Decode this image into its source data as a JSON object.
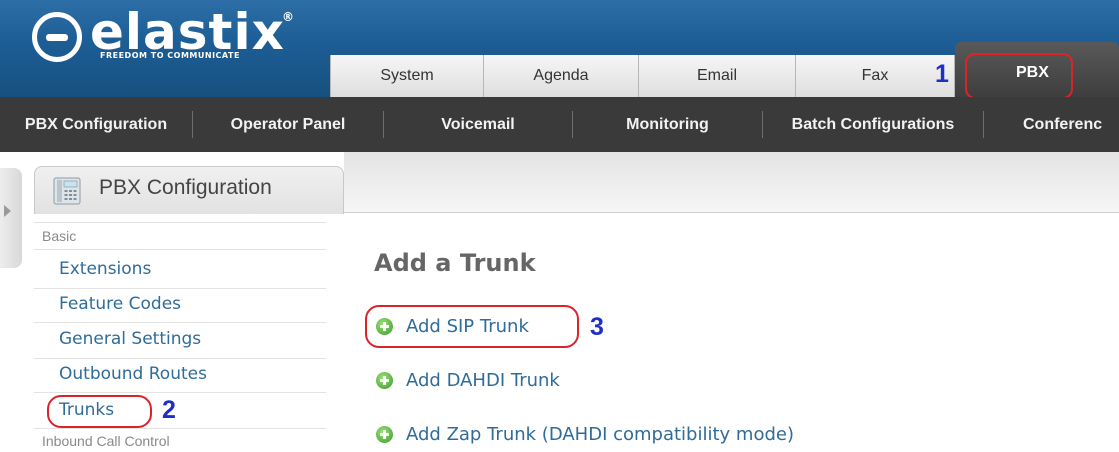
{
  "brand": {
    "name": "elastix",
    "trademark": "®",
    "tagline": "FREEDOM TO COMMUNICATE"
  },
  "top_tabs": [
    {
      "label": "System"
    },
    {
      "label": "Agenda"
    },
    {
      "label": "Email"
    },
    {
      "label": "Fax"
    },
    {
      "label": "PBX",
      "active": true
    }
  ],
  "sub_nav": [
    {
      "label": "PBX Configuration",
      "active": true
    },
    {
      "label": "Operator Panel"
    },
    {
      "label": "Voicemail"
    },
    {
      "label": "Monitoring"
    },
    {
      "label": "Batch Configurations"
    },
    {
      "label": "Conferenc"
    }
  ],
  "panel": {
    "title": "PBX Configuration",
    "icon": "phone-icon"
  },
  "sidebar": {
    "sections": [
      {
        "title": "Basic",
        "items": [
          "Extensions",
          "Feature Codes",
          "General Settings",
          "Outbound Routes",
          "Trunks"
        ]
      },
      {
        "title": "Inbound Call Control"
      }
    ],
    "selected": "Trunks"
  },
  "main": {
    "title": "Add a Trunk",
    "links": [
      {
        "label": "Add SIP Trunk",
        "icon": "add-circle-icon"
      },
      {
        "label": "Add DAHDI Trunk",
        "icon": "add-circle-icon"
      },
      {
        "label": "Add Zap Trunk (DAHDI compatibility mode)",
        "icon": "add-circle-icon"
      }
    ]
  },
  "annotations": {
    "step1": "1",
    "step2": "2",
    "step3": "3"
  },
  "colors": {
    "header_blue": "#1d5d95",
    "nav_dark": "#3a3a3a",
    "link_blue": "#2f6c99",
    "callout_red": "#d9242c",
    "annotation_blue": "#1e2fc8"
  }
}
